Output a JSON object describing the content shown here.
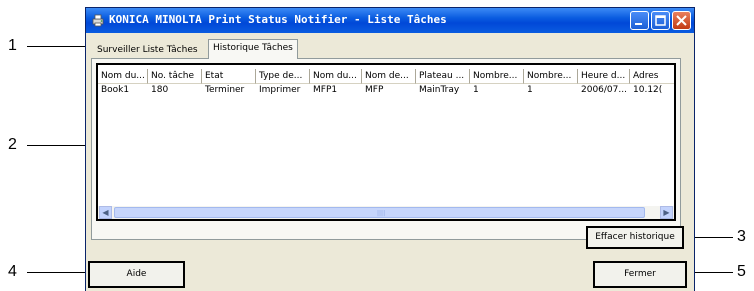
{
  "window": {
    "title": "KONICA MINOLTA Print Status Notifier - Liste Tâches"
  },
  "tabs": [
    {
      "label": "Surveiller Liste Tâches",
      "active": false
    },
    {
      "label": "Historique Tâches",
      "active": true
    }
  ],
  "table": {
    "columns": [
      "Nom du...",
      "No. tâche",
      "Etat",
      "Type de...",
      "Nom du...",
      "Nom de...",
      "Plateau ...",
      "Nombre...",
      "Nombre...",
      "Heure d...",
      "Adres"
    ],
    "rows": [
      [
        "Book1",
        "180",
        "Terminer",
        "Imprimer",
        "MFP1",
        "MFP",
        "MainTray",
        "1",
        "1",
        "2006/07...",
        "10.12("
      ]
    ]
  },
  "buttons": {
    "clear_history": "Effacer historique",
    "help": "Aide",
    "close": "Fermer"
  },
  "callouts": [
    "1",
    "2",
    "3",
    "4",
    "5"
  ]
}
